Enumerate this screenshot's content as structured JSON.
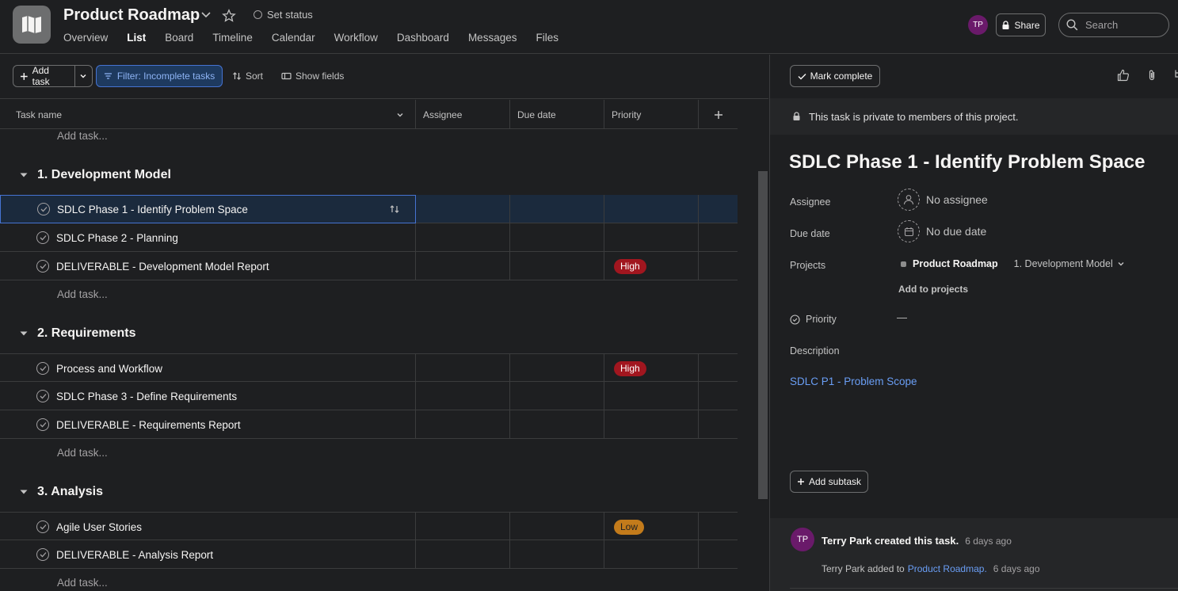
{
  "header": {
    "title": "Product Roadmap",
    "set_status": "Set status",
    "tabs": [
      "Overview",
      "List",
      "Board",
      "Timeline",
      "Calendar",
      "Workflow",
      "Dashboard",
      "Messages",
      "Files"
    ],
    "active_tab": "List",
    "avatar_initials": "TP",
    "share_label": "Share",
    "search_placeholder": "Search"
  },
  "toolbar": {
    "add_task": "Add task",
    "filter": "Filter: Incomplete tasks",
    "sort": "Sort",
    "show_fields": "Show fields"
  },
  "table": {
    "columns": [
      "Task name",
      "Assignee",
      "Due date",
      "Priority"
    ],
    "add_task_placeholder": "Add task...",
    "sections": [
      {
        "name": "1. Development Model",
        "tasks": [
          {
            "name": "SDLC Phase 1 - Identify Problem Space",
            "priority": "",
            "selected": true
          },
          {
            "name": "SDLC Phase 2 - Planning",
            "priority": ""
          },
          {
            "name": "DELIVERABLE - Development Model Report",
            "priority": "High"
          }
        ]
      },
      {
        "name": "2. Requirements",
        "tasks": [
          {
            "name": "Process and Workflow",
            "priority": "High"
          },
          {
            "name": "SDLC Phase 3 - Define Requirements",
            "priority": ""
          },
          {
            "name": "DELIVERABLE - Requirements Report",
            "priority": ""
          }
        ]
      },
      {
        "name": "3. Analysis",
        "tasks": [
          {
            "name": "Agile User Stories",
            "priority": "Low"
          },
          {
            "name": "DELIVERABLE - Analysis Report",
            "priority": ""
          }
        ]
      }
    ]
  },
  "detail": {
    "mark_complete": "Mark complete",
    "private_notice": "This task is private to members of this project.",
    "title": "SDLC Phase 1 - Identify Problem Space",
    "assignee_label": "Assignee",
    "assignee_value": "No assignee",
    "due_label": "Due date",
    "due_value": "No due date",
    "projects_label": "Projects",
    "project_name": "Product Roadmap",
    "project_section": "1. Development Model",
    "add_to_projects": "Add to projects",
    "priority_label": "Priority",
    "priority_value": "—",
    "description_label": "Description",
    "description_link": "SDLC P1 - Problem Scope",
    "add_subtask": "Add subtask",
    "activity": {
      "avatar_initials": "TP",
      "created_text": "Terry Park created this task.",
      "created_time": "6 days ago",
      "added_actor": "Terry Park added to",
      "added_project": "Product Roadmap.",
      "added_time": "6 days ago"
    }
  },
  "colors": {
    "background": "#1e1f21",
    "accent": "#4573d2",
    "priority_high": "#a1161f",
    "priority_low": "#c37b1b",
    "link": "#6a9ef5"
  }
}
